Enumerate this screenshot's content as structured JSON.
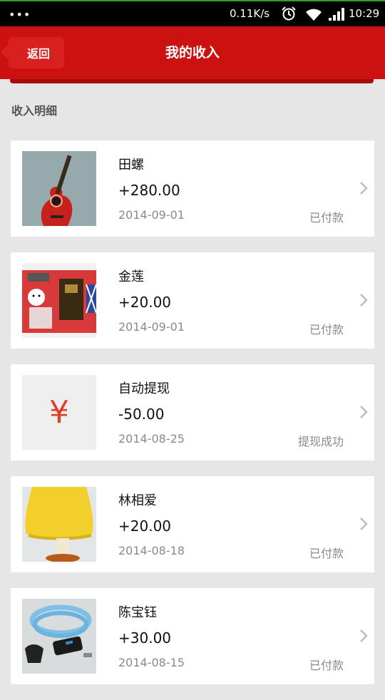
{
  "statusbar": {
    "dots": "•••",
    "speed": "0.11K/s",
    "time": "10:29"
  },
  "header": {
    "back_label": "返回",
    "title": "我的收入"
  },
  "section_title": "收入明细",
  "items": [
    {
      "name": "田螺",
      "amount": "+280.00",
      "date": "2014-09-01",
      "status": "已付款",
      "thumb": "guitar"
    },
    {
      "name": "金莲",
      "amount": "+20.00",
      "date": "2014-09-01",
      "status": "已付款",
      "thumb": "box"
    },
    {
      "name": "自动提现",
      "amount": "-50.00",
      "date": "2014-08-25",
      "status": "提现成功",
      "thumb": "yuan",
      "thumb_symbol": "¥"
    },
    {
      "name": "林相爱",
      "amount": "+20.00",
      "date": "2014-08-18",
      "status": "已付款",
      "thumb": "lamp"
    },
    {
      "name": "陈宝钰",
      "amount": "+30.00",
      "date": "2014-08-15",
      "status": "已付款",
      "thumb": "lock"
    }
  ],
  "colors": {
    "brand_red": "#cc1111",
    "yuan_red": "#d9412b"
  }
}
